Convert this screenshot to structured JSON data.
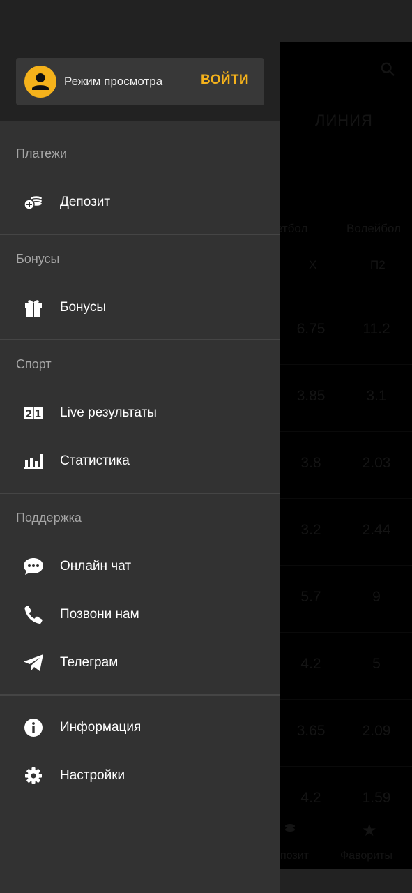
{
  "background": {
    "tab_label": "ЛИНИЯ",
    "columns": [
      {
        "sport": "етбол",
        "outcome": "Х"
      },
      {
        "sport": "Волейбол",
        "outcome": "П2"
      }
    ],
    "rows": [
      [
        "6.75",
        "11.2"
      ],
      [
        "3.85",
        "3.1"
      ],
      [
        "3.8",
        "2.03"
      ],
      [
        "3.2",
        "2.44"
      ],
      [
        "5.7",
        "9"
      ],
      [
        "4.2",
        "5"
      ],
      [
        "3.65",
        "2.09"
      ],
      [
        "4.2",
        "1.59"
      ]
    ],
    "bottom_nav": {
      "deposit_label": "позит",
      "favorites_label": "Фавориты"
    }
  },
  "header": {
    "mode_label": "Режим просмотра",
    "login_label": "ВОЙТИ"
  },
  "sections": [
    {
      "title": "Платежи",
      "items": [
        {
          "label": "Депозит",
          "icon": "coins-icon"
        }
      ]
    },
    {
      "title": "Бонусы",
      "items": [
        {
          "label": "Бонусы",
          "icon": "gift-icon"
        }
      ]
    },
    {
      "title": "Спорт",
      "items": [
        {
          "label": "Live результаты",
          "icon": "scoreboard-icon"
        },
        {
          "label": "Статистика",
          "icon": "bar-chart-icon"
        }
      ]
    },
    {
      "title": "Поддержка",
      "items": [
        {
          "label": "Онлайн чат",
          "icon": "chat-icon"
        },
        {
          "label": "Позвони нам",
          "icon": "phone-icon"
        },
        {
          "label": "Телеграм",
          "icon": "telegram-icon"
        }
      ]
    },
    {
      "title": "",
      "items": [
        {
          "label": "Информация",
          "icon": "info-icon"
        },
        {
          "label": "Настройки",
          "icon": "gear-icon"
        }
      ]
    }
  ],
  "colors": {
    "accent": "#f5b21b",
    "drawer_bg": "#323232",
    "header_bg": "#222222",
    "divider": "#454545"
  }
}
